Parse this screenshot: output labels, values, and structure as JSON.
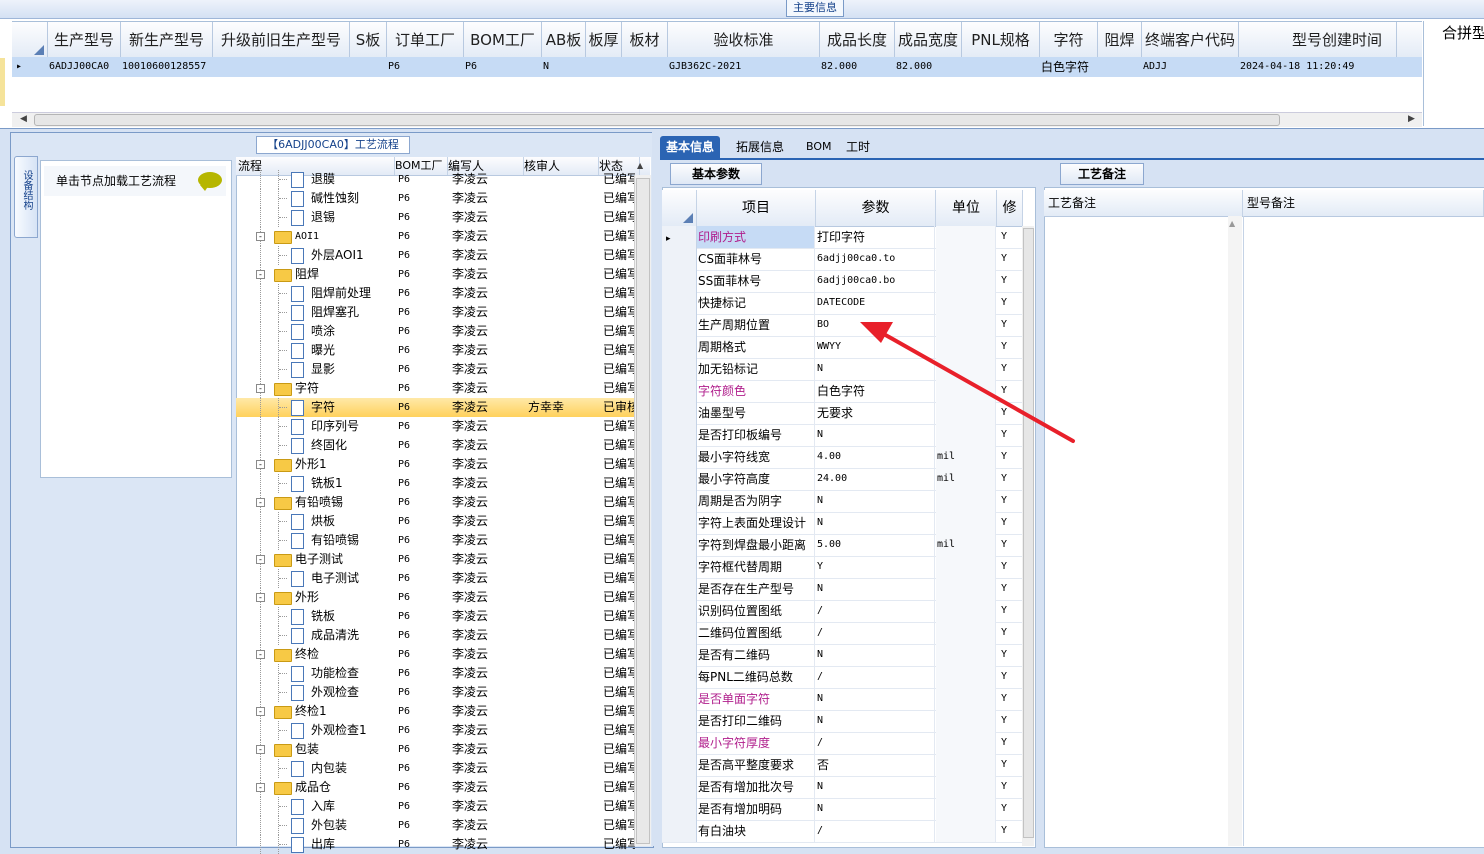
{
  "top": {
    "section_title": "主要信息",
    "merge_header": "合拼型",
    "columns": [
      "生产型号",
      "新生产型号",
      "升级前旧生产型号",
      "S板",
      "订单工厂",
      "BOM工厂",
      "AB板",
      "板厚",
      "板材",
      "验收标准",
      "成品长度",
      "成品宽度",
      "PNL规格",
      "字符",
      "阻焊",
      "终端客户代码",
      "型号创建时间"
    ],
    "row": {
      "marker": "▸",
      "cells": [
        "6ADJJ00CA0",
        "10010600128557",
        "",
        "",
        "P6",
        "P6",
        "N",
        "",
        "",
        "GJB362C-2021",
        "82.000",
        "82.000",
        "",
        "白色字符",
        "",
        "ADJJ",
        "2024-04-18 11:20:49"
      ]
    }
  },
  "left": {
    "process_title": "【6ADJJ00CA0】工艺流程",
    "vertical_tab": "设备结构",
    "node_hint": "单击节点加载工艺流程"
  },
  "tree": {
    "headers": [
      "流程",
      "BOM工厂",
      "编写人",
      "核审人",
      "状态"
    ],
    "rows": [
      {
        "name": "退膜",
        "kind": "doc",
        "level": 2,
        "bom": "P6",
        "writer": "李凌云",
        "reviewer": "",
        "status": "已编写"
      },
      {
        "name": "碱性蚀刻",
        "kind": "doc",
        "level": 2,
        "bom": "P6",
        "writer": "李凌云",
        "reviewer": "",
        "status": "已编写"
      },
      {
        "name": "退锡",
        "kind": "doc",
        "level": 2,
        "bom": "P6",
        "writer": "李凌云",
        "reviewer": "",
        "status": "已编写"
      },
      {
        "name": "AOI1",
        "kind": "folder",
        "level": 1,
        "bom": "P6",
        "writer": "李凌云",
        "reviewer": "",
        "status": "已编写"
      },
      {
        "name": "外层AOI1",
        "kind": "doc",
        "level": 2,
        "bom": "P6",
        "writer": "李凌云",
        "reviewer": "",
        "status": "已编写"
      },
      {
        "name": "阻焊",
        "kind": "folder",
        "level": 1,
        "bom": "P6",
        "writer": "李凌云",
        "reviewer": "",
        "status": "已编写"
      },
      {
        "name": "阻焊前处理",
        "kind": "doc",
        "level": 2,
        "bom": "P6",
        "writer": "李凌云",
        "reviewer": "",
        "status": "已编写"
      },
      {
        "name": "阻焊塞孔",
        "kind": "doc",
        "level": 2,
        "bom": "P6",
        "writer": "李凌云",
        "reviewer": "",
        "status": "已编写"
      },
      {
        "name": "喷涂",
        "kind": "doc",
        "level": 2,
        "bom": "P6",
        "writer": "李凌云",
        "reviewer": "",
        "status": "已编写"
      },
      {
        "name": "曝光",
        "kind": "doc",
        "level": 2,
        "bom": "P6",
        "writer": "李凌云",
        "reviewer": "",
        "status": "已编写"
      },
      {
        "name": "显影",
        "kind": "doc",
        "level": 2,
        "bom": "P6",
        "writer": "李凌云",
        "reviewer": "",
        "status": "已编写"
      },
      {
        "name": "字符",
        "kind": "folder",
        "level": 1,
        "bom": "P6",
        "writer": "李凌云",
        "reviewer": "",
        "status": "已编写"
      },
      {
        "name": "字符",
        "kind": "doc",
        "level": 2,
        "bom": "P6",
        "writer": "李凌云",
        "reviewer": "方幸幸",
        "status": "已审核",
        "selected": true
      },
      {
        "name": "印序列号",
        "kind": "doc",
        "level": 2,
        "bom": "P6",
        "writer": "李凌云",
        "reviewer": "",
        "status": "已编写"
      },
      {
        "name": "终固化",
        "kind": "doc",
        "level": 2,
        "bom": "P6",
        "writer": "李凌云",
        "reviewer": "",
        "status": "已编写"
      },
      {
        "name": "外形1",
        "kind": "folder",
        "level": 1,
        "bom": "P6",
        "writer": "李凌云",
        "reviewer": "",
        "status": "已编写"
      },
      {
        "name": "铣板1",
        "kind": "doc",
        "level": 2,
        "bom": "P6",
        "writer": "李凌云",
        "reviewer": "",
        "status": "已编写"
      },
      {
        "name": "有铅喷锡",
        "kind": "folder",
        "level": 1,
        "bom": "P6",
        "writer": "李凌云",
        "reviewer": "",
        "status": "已编写"
      },
      {
        "name": "烘板",
        "kind": "doc",
        "level": 2,
        "bom": "P6",
        "writer": "李凌云",
        "reviewer": "",
        "status": "已编写"
      },
      {
        "name": "有铅喷锡",
        "kind": "doc",
        "level": 2,
        "bom": "P6",
        "writer": "李凌云",
        "reviewer": "",
        "status": "已编写"
      },
      {
        "name": "电子测试",
        "kind": "folder",
        "level": 1,
        "bom": "P6",
        "writer": "李凌云",
        "reviewer": "",
        "status": "已编写"
      },
      {
        "name": "电子测试",
        "kind": "doc",
        "level": 2,
        "bom": "P6",
        "writer": "李凌云",
        "reviewer": "",
        "status": "已编写"
      },
      {
        "name": "外形",
        "kind": "folder",
        "level": 1,
        "bom": "P6",
        "writer": "李凌云",
        "reviewer": "",
        "status": "已编写"
      },
      {
        "name": "铣板",
        "kind": "doc",
        "level": 2,
        "bom": "P6",
        "writer": "李凌云",
        "reviewer": "",
        "status": "已编写"
      },
      {
        "name": "成品清洗",
        "kind": "doc",
        "level": 2,
        "bom": "P6",
        "writer": "李凌云",
        "reviewer": "",
        "status": "已编写"
      },
      {
        "name": "终检",
        "kind": "folder",
        "level": 1,
        "bom": "P6",
        "writer": "李凌云",
        "reviewer": "",
        "status": "已编写"
      },
      {
        "name": "功能检查",
        "kind": "doc",
        "level": 2,
        "bom": "P6",
        "writer": "李凌云",
        "reviewer": "",
        "status": "已编写"
      },
      {
        "name": "外观检查",
        "kind": "doc",
        "level": 2,
        "bom": "P6",
        "writer": "李凌云",
        "reviewer": "",
        "status": "已编写"
      },
      {
        "name": "终检1",
        "kind": "folder",
        "level": 1,
        "bom": "P6",
        "writer": "李凌云",
        "reviewer": "",
        "status": "已编写"
      },
      {
        "name": "外观检查1",
        "kind": "doc",
        "level": 2,
        "bom": "P6",
        "writer": "李凌云",
        "reviewer": "",
        "status": "已编写"
      },
      {
        "name": "包装",
        "kind": "folder",
        "level": 1,
        "bom": "P6",
        "writer": "李凌云",
        "reviewer": "",
        "status": "已编写"
      },
      {
        "name": "内包装",
        "kind": "doc",
        "level": 2,
        "bom": "P6",
        "writer": "李凌云",
        "reviewer": "",
        "status": "已编写"
      },
      {
        "name": "成品仓",
        "kind": "folder",
        "level": 1,
        "bom": "P6",
        "writer": "李凌云",
        "reviewer": "",
        "status": "已编写"
      },
      {
        "name": "入库",
        "kind": "doc",
        "level": 2,
        "bom": "P6",
        "writer": "李凌云",
        "reviewer": "",
        "status": "已编写"
      },
      {
        "name": "外包装",
        "kind": "doc",
        "level": 2,
        "bom": "P6",
        "writer": "李凌云",
        "reviewer": "",
        "status": "已编写"
      },
      {
        "name": "出库",
        "kind": "doc",
        "level": 2,
        "bom": "P6",
        "writer": "李凌云",
        "reviewer": "",
        "status": "已编写"
      }
    ]
  },
  "right": {
    "tabs": [
      "基本信息",
      "拓展信息",
      "BOM",
      "工时"
    ],
    "basic_params_title": "基本参数",
    "grid_headers": [
      "项目",
      "参数",
      "单位",
      "修"
    ],
    "rows": [
      {
        "item": "印刷方式",
        "param": "打印字符",
        "unit": "",
        "edit": "Y",
        "highlight": true,
        "current": true
      },
      {
        "item": "CS面菲林号",
        "param": "6adjj00ca0.to",
        "unit": "",
        "edit": "Y"
      },
      {
        "item": "SS面菲林号",
        "param": "6adjj00ca0.bo",
        "unit": "",
        "edit": "Y"
      },
      {
        "item": "快捷标记",
        "param": "DATECODE",
        "unit": "",
        "edit": "Y"
      },
      {
        "item": "生产周期位置",
        "param": "BO",
        "unit": "",
        "edit": "Y"
      },
      {
        "item": "周期格式",
        "param": "WWYY",
        "unit": "",
        "edit": "Y"
      },
      {
        "item": "加无铅标记",
        "param": "N",
        "unit": "",
        "edit": "Y"
      },
      {
        "item": "字符颜色",
        "param": "白色字符",
        "unit": "",
        "edit": "Y",
        "highlight": true
      },
      {
        "item": "油墨型号",
        "param": "无要求",
        "unit": "",
        "edit": "Y"
      },
      {
        "item": "是否打印板编号",
        "param": "N",
        "unit": "",
        "edit": "Y"
      },
      {
        "item": "最小字符线宽",
        "param": "4.00",
        "unit": "mil",
        "edit": "Y"
      },
      {
        "item": "最小字符高度",
        "param": "24.00",
        "unit": "mil",
        "edit": "Y"
      },
      {
        "item": "周期是否为阴字",
        "param": "N",
        "unit": "",
        "edit": "Y"
      },
      {
        "item": "字符上表面处理设计",
        "param": "N",
        "unit": "",
        "edit": "Y"
      },
      {
        "item": "字符到焊盘最小距离",
        "param": "5.00",
        "unit": "mil",
        "edit": "Y"
      },
      {
        "item": "字符框代替周期",
        "param": "Y",
        "unit": "",
        "edit": "Y"
      },
      {
        "item": "是否存在生产型号",
        "param": "N",
        "unit": "",
        "edit": "Y"
      },
      {
        "item": "识别码位置图纸",
        "param": "/",
        "unit": "",
        "edit": "Y"
      },
      {
        "item": "二维码位置图纸",
        "param": "/",
        "unit": "",
        "edit": "Y"
      },
      {
        "item": "是否有二维码",
        "param": "N",
        "unit": "",
        "edit": "Y"
      },
      {
        "item": "每PNL二维码总数",
        "param": "/",
        "unit": "",
        "edit": "Y"
      },
      {
        "item": "是否单面字符",
        "param": "N",
        "unit": "",
        "edit": "Y",
        "highlight": true
      },
      {
        "item": "是否打印二维码",
        "param": "N",
        "unit": "",
        "edit": "Y"
      },
      {
        "item": "最小字符厚度",
        "param": "/",
        "unit": "",
        "edit": "Y",
        "highlight": true
      },
      {
        "item": "是否高平整度要求",
        "param": "否",
        "unit": "",
        "edit": "Y"
      },
      {
        "item": "是否有增加批次号",
        "param": "N",
        "unit": "",
        "edit": "Y"
      },
      {
        "item": "是否有增加明码",
        "param": "N",
        "unit": "",
        "edit": "Y"
      },
      {
        "item": "有白油块",
        "param": "/",
        "unit": "",
        "edit": "Y"
      }
    ],
    "remarks_title": "工艺备注",
    "remark_headers": [
      "工艺备注",
      "型号备注"
    ]
  },
  "colors": {
    "highlight_item": "#b01e8c",
    "selected_row": "#ffd86a",
    "arrow": "#e8202a",
    "tab_active": "#2b64b3"
  }
}
